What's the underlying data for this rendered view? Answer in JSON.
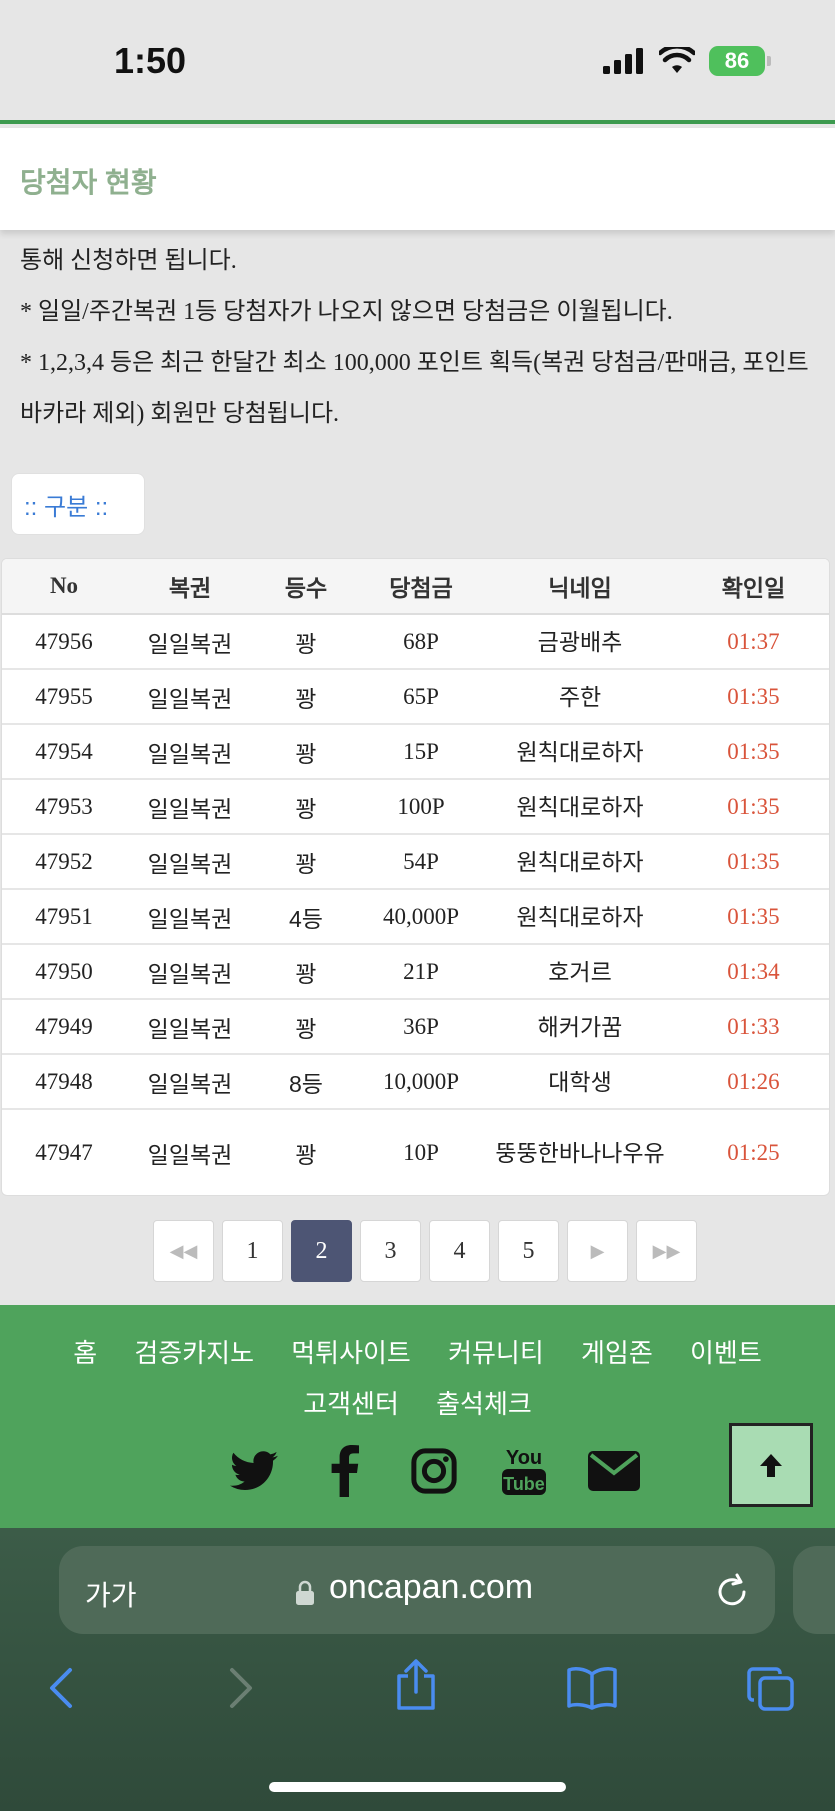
{
  "status": {
    "time": "1:50",
    "battery": "86"
  },
  "page_title": "당첨자 현황",
  "notice_lines": [
    "통해 신청하면 됩니다.",
    "* 일일/주간복권 1등 당첨자가 나오지 않으면 당첨금은 이월됩니다.",
    "* 1,2,3,4 등은 최근 한달간 최소 100,000 포인트 획득(복권 당첨금/판매금, 포인트 바카라 제외) 회원만 당첨됩니다."
  ],
  "category_label": ":: 구분 ::",
  "table": {
    "headers": [
      "No",
      "복권",
      "등수",
      "당첨금",
      "닉네임",
      "확인일"
    ],
    "rows": [
      [
        "47956",
        "일일복권",
        "꽝",
        "68P",
        "금광배추",
        "01:37"
      ],
      [
        "47955",
        "일일복권",
        "꽝",
        "65P",
        "주한",
        "01:35"
      ],
      [
        "47954",
        "일일복권",
        "꽝",
        "15P",
        "원칙대로하자",
        "01:35"
      ],
      [
        "47953",
        "일일복권",
        "꽝",
        "100P",
        "원칙대로하자",
        "01:35"
      ],
      [
        "47952",
        "일일복권",
        "꽝",
        "54P",
        "원칙대로하자",
        "01:35"
      ],
      [
        "47951",
        "일일복권",
        "4등",
        "40,000P",
        "원칙대로하자",
        "01:35"
      ],
      [
        "47950",
        "일일복권",
        "꽝",
        "21P",
        "호거르",
        "01:34"
      ],
      [
        "47949",
        "일일복권",
        "꽝",
        "36P",
        "해커가꿈",
        "01:33"
      ],
      [
        "47948",
        "일일복권",
        "8등",
        "10,000P",
        "대학생",
        "01:26"
      ],
      [
        "47947",
        "일일복권",
        "꽝",
        "10P",
        "뚱뚱한바나나우유",
        "01:25"
      ]
    ]
  },
  "pagination": {
    "pages": [
      "1",
      "2",
      "3",
      "4",
      "5"
    ],
    "current": "2"
  },
  "footer": {
    "menu_row1": [
      "홈",
      "검증카지노",
      "먹튀사이트",
      "커뮤니티",
      "게임존",
      "이벤트"
    ],
    "menu_row2": [
      "고객센터",
      "출석체크"
    ],
    "social_icons": [
      "twitter-icon",
      "facebook-icon",
      "instagram-icon",
      "youtube-icon",
      "mail-icon"
    ]
  },
  "browser": {
    "text_size_label": "가가",
    "url": "oncapan.com"
  },
  "colors": {
    "accent_green": "#4fa35c",
    "time_red": "#d9543b",
    "active_page": "#4d5574"
  }
}
